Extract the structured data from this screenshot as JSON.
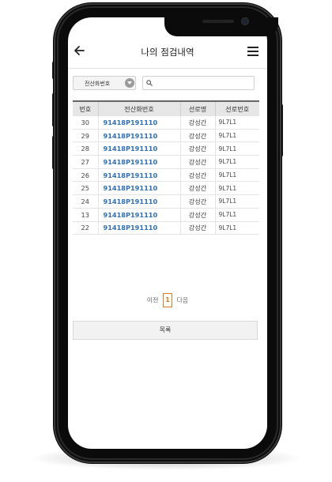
{
  "header": {
    "title": "나의 점검내역"
  },
  "search": {
    "select_value": "전산화번호",
    "input_value": ""
  },
  "table": {
    "columns": [
      "번호",
      "전산화번호",
      "선로명",
      "선로번호"
    ],
    "rows": [
      [
        "30",
        "91418P191110",
        "강성간",
        "9L7L1"
      ],
      [
        "29",
        "91418P191110",
        "강성간",
        "9L7L1"
      ],
      [
        "28",
        "91418P191110",
        "강성간",
        "9L7L1"
      ],
      [
        "27",
        "91418P191110",
        "강성간",
        "9L7L1"
      ],
      [
        "26",
        "91418P191110",
        "강성간",
        "9L7L1"
      ],
      [
        "25",
        "91418P191110",
        "강성간",
        "9L7L1"
      ],
      [
        "24",
        "91418P191110",
        "강성간",
        "9L7L1"
      ],
      [
        "13",
        "91418P191110",
        "강성간",
        "9L7L1"
      ],
      [
        "22",
        "91418P191110",
        "강성간",
        "9L7L1"
      ]
    ]
  },
  "pagination": {
    "prev_label": "이전",
    "current_page": "1",
    "next_label": "다음"
  },
  "list_button_label": "목록",
  "icons": {
    "back": "arrow-left-icon",
    "menu": "hamburger-menu-icon",
    "search": "search-icon",
    "dropdown": "chevron-down-icon"
  },
  "colors": {
    "link": "#2f6fb2",
    "active_page": "#e07a1f",
    "header_bg": "#e6e6e6"
  }
}
